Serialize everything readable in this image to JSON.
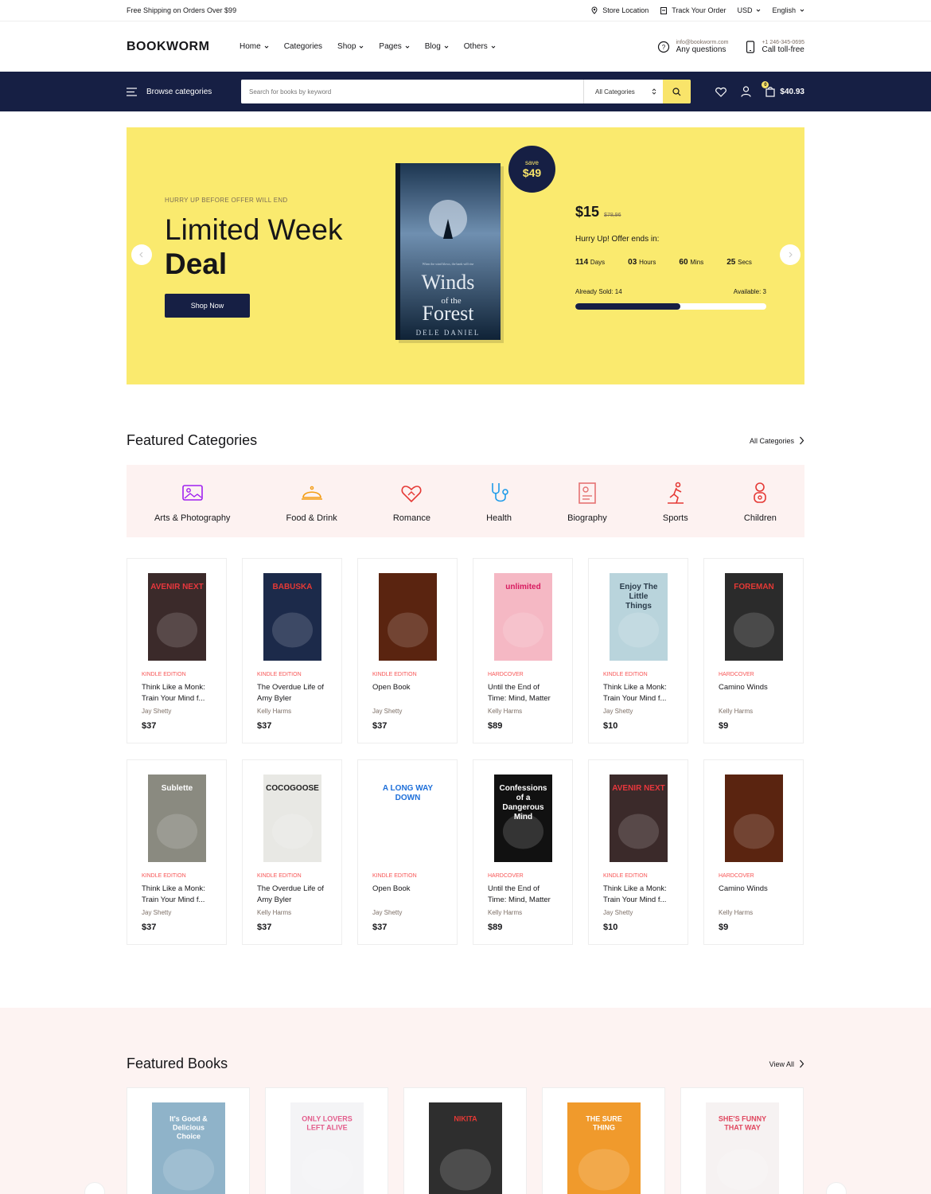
{
  "topbar": {
    "promo": "Free Shipping on Orders Over $99",
    "store_location": "Store Location",
    "track_order": "Track Your Order",
    "currency": "USD",
    "language": "English"
  },
  "header": {
    "logo": "BOOKWORM",
    "nav": [
      "Home",
      "Categories",
      "Shop",
      "Pages",
      "Blog",
      "Others"
    ],
    "contact_email": "info@bookworm.com",
    "contact_email_label": "Any questions",
    "contact_phone": "+1 246-345-0695",
    "contact_phone_label": "Call toll-free"
  },
  "searchbar": {
    "browse": "Browse categories",
    "placeholder": "Search for books by keyword",
    "category": "All Categories",
    "cart_count": "0",
    "cart_total": "$40.93"
  },
  "hero": {
    "kicker": "HURRY UP BEFORE OFFER WILL END",
    "title_line1": "Limited Week",
    "title_line2": "Deal",
    "cta": "Shop Now",
    "save_label": "save",
    "save_value": "$49",
    "book_title_top": "Winds",
    "book_title_mid": "of the",
    "book_title_bottom": "Forest",
    "book_author": "DELE DANIEL",
    "book_tagline": "When the wind blows, the bank will rise",
    "price": "$15",
    "old_price": "$78,96",
    "offer_text": "Hurry Up! Offer ends in:",
    "countdown": [
      {
        "value": "114",
        "unit": "Days"
      },
      {
        "value": "03",
        "unit": "Hours"
      },
      {
        "value": "60",
        "unit": "Mins"
      },
      {
        "value": "25",
        "unit": "Secs"
      }
    ],
    "sold_label": "Already Sold: 14",
    "available_label": "Available: 3",
    "sold_fraction": 0.55
  },
  "featured_categories": {
    "title": "Featured Categories",
    "link": "All Categories",
    "items": [
      {
        "label": "Arts & Photography",
        "color": "#a020f0"
      },
      {
        "label": "Food & Drink",
        "color": "#f39c12"
      },
      {
        "label": "Romance",
        "color": "#e53935"
      },
      {
        "label": "Health",
        "color": "#1e9be9"
      },
      {
        "label": "Biography",
        "color": "#e57373"
      },
      {
        "label": "Sports",
        "color": "#e53935"
      },
      {
        "label": "Children",
        "color": "#e53935"
      }
    ]
  },
  "products": [
    {
      "format": "KINDLE EDITION",
      "title": "Think Like a Monk: Train Your Mind f...",
      "author": "Jay Shetty",
      "price": "$37",
      "cover_text": "AVENIR NEXT",
      "cover_bg": "#3b2a2a",
      "cover_fg": "#e8373d"
    },
    {
      "format": "KINDLE EDITION",
      "title": "The Overdue Life of Amy Byler",
      "author": "Kelly Harms",
      "price": "$37",
      "cover_text": "BABUSKA",
      "cover_bg": "#1c2a4a",
      "cover_fg": "#e53935"
    },
    {
      "format": "KINDLE EDITION",
      "title": "Open Book",
      "author": "Jay Shetty",
      "price": "$37",
      "cover_text": "",
      "cover_bg": "#5a2410",
      "cover_fg": "#f26b2b"
    },
    {
      "format": "HARDCOVER",
      "title": "Until the End of Time: Mind, Matter",
      "author": "Kelly Harms",
      "price": "$89",
      "cover_text": "unlimited",
      "cover_bg": "#f5b8c4",
      "cover_fg": "#d81b60"
    },
    {
      "format": "KINDLE EDITION",
      "title": "Think Like a Monk: Train Your Mind f...",
      "author": "Jay Shetty",
      "price": "$10",
      "cover_text": "Enjoy The Little Things",
      "cover_bg": "#b9d4dc",
      "cover_fg": "#2a3b4a"
    },
    {
      "format": "HARDCOVER",
      "title": "Camino Winds",
      "author": "Kelly Harms",
      "price": "$9",
      "cover_text": "FOREMAN",
      "cover_bg": "#2b2b2b",
      "cover_fg": "#e53935"
    },
    {
      "format": "KINDLE EDITION",
      "title": "Think Like a Monk: Train Your Mind f...",
      "author": "Jay Shetty",
      "price": "$37",
      "cover_text": "Sublette",
      "cover_bg": "#8a8a80",
      "cover_fg": "#ffffff"
    },
    {
      "format": "KINDLE EDITION",
      "title": "The Overdue Life of Amy Byler",
      "author": "Kelly Harms",
      "price": "$37",
      "cover_text": "COCOGOOSE",
      "cover_bg": "#e8e8e4",
      "cover_fg": "#222222"
    },
    {
      "format": "KINDLE EDITION",
      "title": "Open Book",
      "author": "Jay Shetty",
      "price": "$37",
      "cover_text": "A LONG WAY DOWN",
      "cover_bg": "#ffffff",
      "cover_fg": "#1e6fd9"
    },
    {
      "format": "HARDCOVER",
      "title": "Until the End of Time: Mind, Matter",
      "author": "Kelly Harms",
      "price": "$89",
      "cover_text": "Confessions of a Dangerous Mind",
      "cover_bg": "#111111",
      "cover_fg": "#ffffff"
    },
    {
      "format": "KINDLE EDITION",
      "title": "Think Like a Monk: Train Your Mind f...",
      "author": "Jay Shetty",
      "price": "$10",
      "cover_text": "AVENIR NEXT",
      "cover_bg": "#3b2a2a",
      "cover_fg": "#e8373d"
    },
    {
      "format": "HARDCOVER",
      "title": "Camino Winds",
      "author": "Kelly Harms",
      "price": "$9",
      "cover_text": "",
      "cover_bg": "#5a2410",
      "cover_fg": "#f26b2b"
    }
  ],
  "featured_books": {
    "title": "Featured Books",
    "link": "View All",
    "items": [
      {
        "cover_text": "It's Good & Delicious Choice",
        "cover_bg": "#8fb3c9",
        "cover_fg": "#ffffff"
      },
      {
        "cover_text": "ONLY LOVERS LEFT ALIVE",
        "cover_bg": "#f4f4f6",
        "cover_fg": "#e35d8c"
      },
      {
        "cover_text": "NIKITA",
        "cover_bg": "#2e2e2e",
        "cover_fg": "#e53935"
      },
      {
        "cover_text": "THE SURE THING",
        "cover_bg": "#f09a2c",
        "cover_fg": "#ffffff"
      },
      {
        "cover_text": "SHE'S FUNNY THAT WAY",
        "cover_bg": "#f6f2f2",
        "cover_fg": "#e0475f"
      }
    ]
  }
}
